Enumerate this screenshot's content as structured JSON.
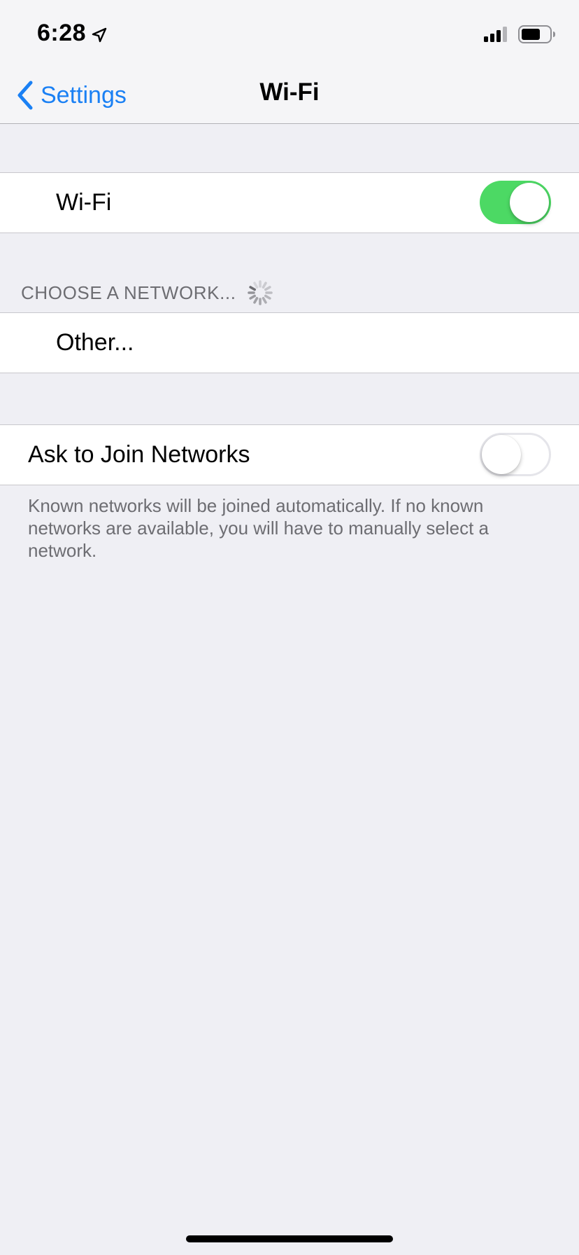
{
  "status_bar": {
    "time": "6:28",
    "location_icon": "location-arrow-icon",
    "signal_icon": "cellular-signal-icon",
    "battery_icon": "battery-icon"
  },
  "nav": {
    "back_label": "Settings",
    "back_icon": "chevron-left-icon",
    "title": "Wi-Fi"
  },
  "wifi_toggle": {
    "label": "Wi-Fi",
    "on": true
  },
  "networks": {
    "section_header": "CHOOSE A NETWORK...",
    "loading_icon": "activity-spinner-icon",
    "items": [
      {
        "label": "Other..."
      }
    ]
  },
  "ask_to_join": {
    "label": "Ask to Join Networks",
    "on": false,
    "footer": "Known networks will be joined automatically. If no known networks are available, you will have to manually select a network."
  },
  "colors": {
    "accent": "#1a80f4",
    "toggle_on": "#4cd964",
    "background": "#efeff4",
    "secondary_text": "#6d6d72"
  }
}
